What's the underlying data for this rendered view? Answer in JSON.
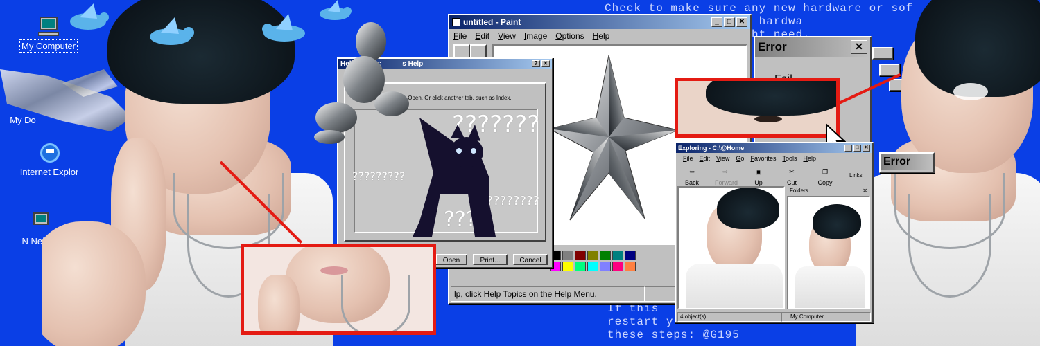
{
  "bsod": {
    "top_lines": "Check to make sure any new hardware or sof\n    llation,ask your hardwa\n        ates you might need.",
    "bottom_lines": "If this\nrestart y\nthese steps: @G195"
  },
  "desktop_icons": [
    {
      "name": "my-computer",
      "label": "My Computer"
    },
    {
      "name": "my-documents",
      "label": "My Do"
    },
    {
      "name": "internet-explorer",
      "label": "Internet Explor"
    },
    {
      "name": "network-neighborhood",
      "label": "N Neigh"
    }
  ],
  "paint": {
    "title": "untitled - Paint",
    "menu": [
      "File",
      "Edit",
      "View",
      "Image",
      "Options",
      "Help"
    ],
    "status": "lp, click Help Topics on the Help Menu."
  },
  "help": {
    "title": "Help Topics:",
    "title_suffix": "s Help",
    "instruction": "then  . Open. Or click another tab, such as Index.",
    "qmarks": [
      "???????",
      "?????????",
      "?????????",
      "????"
    ],
    "buttons": {
      "open": "Open",
      "print": "Print...",
      "cancel": "Cancel"
    }
  },
  "error": {
    "title": "Error",
    "body": "Fail",
    "close": "✕",
    "side_title": "Error"
  },
  "explorer": {
    "title": "Exploring - C:\\@Home",
    "menu": [
      "File",
      "Edit",
      "View",
      "Go",
      "Favorites",
      "Tools",
      "Help"
    ],
    "toolbar": [
      "Back",
      "Forward",
      "Up",
      "Cut",
      "Copy"
    ],
    "links": "Links",
    "folders_label": "Folders",
    "status_left": "4 object(s)",
    "status_right": "My Computer"
  },
  "colors": {
    "desktop": "#0a3fe6",
    "title_active": "#0a246a",
    "accent_red": "#e41b13",
    "palette": [
      "#000000",
      "#808080",
      "#800000",
      "#808000",
      "#008000",
      "#008080",
      "#000080",
      "#ffffff",
      "#c0c0c0",
      "#ff0000",
      "#ffff00",
      "#00ff00",
      "#00ffff",
      "#0000ff",
      "#800080",
      "#808040",
      "#004040",
      "#0080ff",
      "#004080",
      "#8000ff",
      "#804000",
      "#ff00ff",
      "#ffff80",
      "#00ff80",
      "#80ffff",
      "#8080ff",
      "#ff0080",
      "#ff8040"
    ]
  }
}
